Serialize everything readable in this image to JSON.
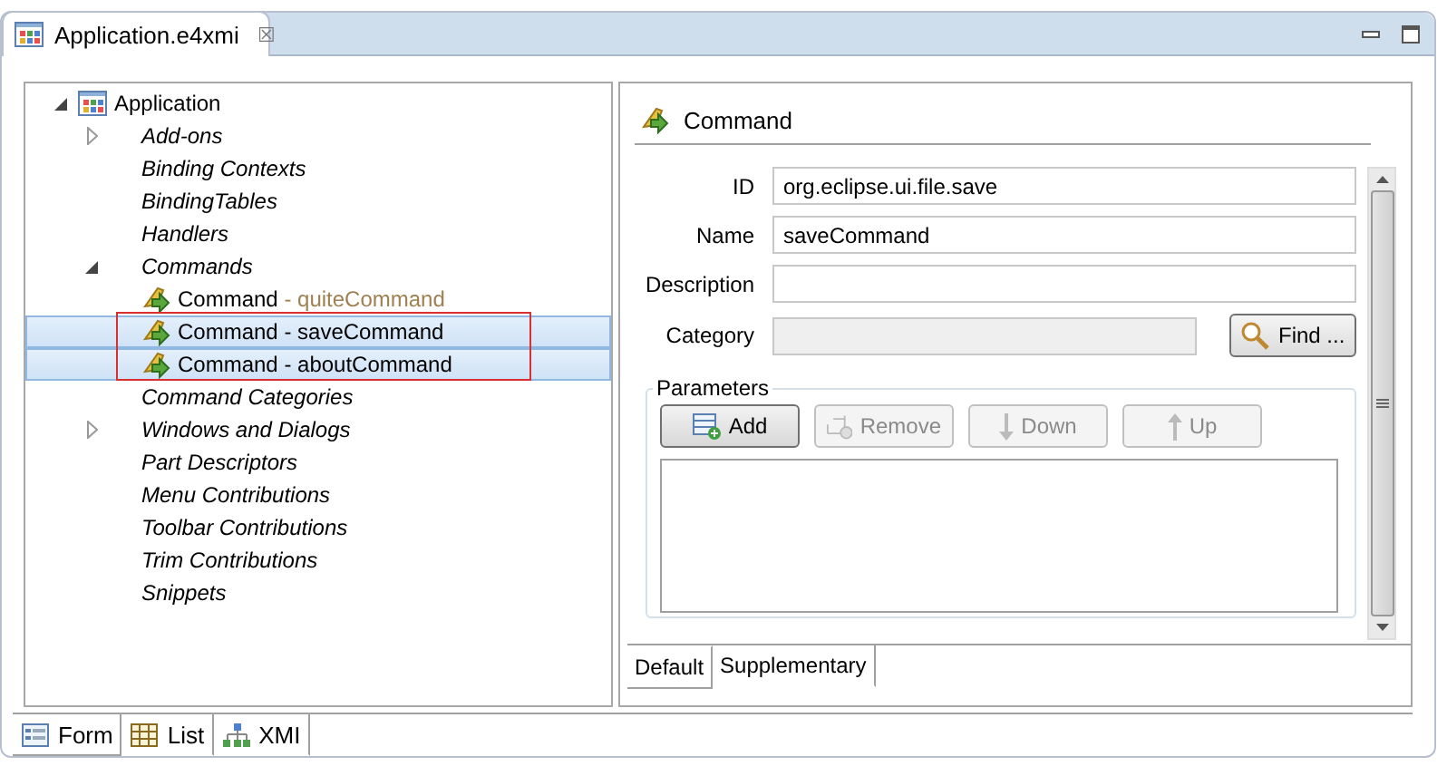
{
  "editor_tab": {
    "title": "Application.e4xmi",
    "close": "☒"
  },
  "tree": {
    "items": [
      {
        "label": "Application",
        "expanded": true,
        "kind": "app",
        "selected": false,
        "children": [
          {
            "label": "Add-ons",
            "expanded": false,
            "kind": "folder",
            "selected": false
          },
          {
            "label": "Binding Contexts",
            "kind": "folder",
            "selected": false
          },
          {
            "label": "BindingTables",
            "kind": "folder",
            "selected": false
          },
          {
            "label": "Handlers",
            "kind": "folder",
            "selected": false
          },
          {
            "label": "Commands",
            "expanded": true,
            "kind": "folder",
            "selected": false,
            "children": [
              {
                "label": "Command",
                "detail": " - quiteCommand",
                "kind": "command",
                "selected": false
              },
              {
                "label": "Command",
                "detail": " - saveCommand",
                "kind": "command",
                "selected": true
              },
              {
                "label": "Command",
                "detail": " - aboutCommand",
                "kind": "command",
                "selected": true
              }
            ]
          },
          {
            "label": "Command Categories",
            "kind": "folder",
            "selected": false
          },
          {
            "label": "Windows and Dialogs",
            "expanded": false,
            "kind": "folder",
            "selected": false
          },
          {
            "label": "Part Descriptors",
            "kind": "folder",
            "selected": false
          },
          {
            "label": "Menu Contributions",
            "kind": "folder",
            "selected": false
          },
          {
            "label": "Toolbar Contributions",
            "kind": "folder",
            "selected": false
          },
          {
            "label": "Trim Contributions",
            "kind": "folder",
            "selected": false
          },
          {
            "label": "Snippets",
            "kind": "folder",
            "selected": false
          }
        ]
      }
    ]
  },
  "detail": {
    "title": "Command",
    "fields": [
      {
        "label": "ID",
        "value": "org.eclipse.ui.file.save",
        "disabled": false
      },
      {
        "label": "Name",
        "value": "saveCommand",
        "disabled": false
      },
      {
        "label": "Description",
        "disabled": false
      },
      {
        "label": "Category",
        "disabled": true,
        "button": "Find ..."
      }
    ],
    "parameters": {
      "title": "Parameters",
      "buttons": [
        {
          "label": "Add",
          "kind": "add",
          "disabled": false
        },
        {
          "label": "Remove",
          "kind": "remove",
          "disabled": true
        },
        {
          "label": "Down",
          "kind": "down",
          "disabled": true
        },
        {
          "label": "Up",
          "kind": "up",
          "disabled": true
        }
      ]
    },
    "tabs": [
      {
        "label": "Default",
        "selected": true
      },
      {
        "label": "Supplementary",
        "selected": false
      }
    ]
  },
  "bottom_tabs": [
    {
      "label": "Form",
      "kind": "form",
      "selected": true
    },
    {
      "label": "List",
      "kind": "list",
      "selected": false
    },
    {
      "label": "XMI",
      "kind": "xmi",
      "selected": false
    }
  ]
}
